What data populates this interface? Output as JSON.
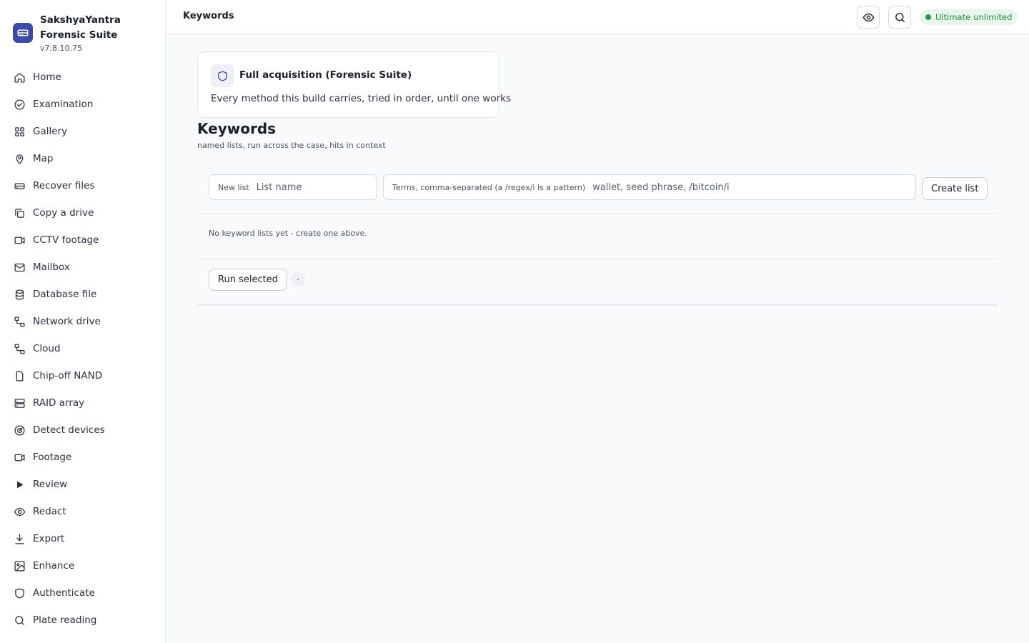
{
  "app": {
    "name": "SakshyaYantra Forensic Suite",
    "version": "v7.8.10.75"
  },
  "sidebar": {
    "items": [
      {
        "label": "Home",
        "icon": "home-icon"
      },
      {
        "label": "Examination",
        "icon": "check-circle-icon"
      },
      {
        "label": "Gallery",
        "icon": "grid-icon"
      },
      {
        "label": "Map",
        "icon": "map-pin-icon"
      },
      {
        "label": "Recover files",
        "icon": "hard-drive-icon"
      },
      {
        "label": "Copy a drive",
        "icon": "copy-icon"
      },
      {
        "label": "CCTV footage",
        "icon": "video-icon"
      },
      {
        "label": "Mailbox",
        "icon": "mail-icon"
      },
      {
        "label": "Database file",
        "icon": "database-icon"
      },
      {
        "label": "Network drive",
        "icon": "network-icon"
      },
      {
        "label": "Cloud",
        "icon": "cloud-icon"
      },
      {
        "label": "Chip-off NAND",
        "icon": "chip-icon"
      },
      {
        "label": "RAID array",
        "icon": "server-icon"
      },
      {
        "label": "Detect devices",
        "icon": "radar-icon"
      },
      {
        "label": "Footage",
        "icon": "video-icon"
      },
      {
        "label": "Review",
        "icon": "play-icon"
      },
      {
        "label": "Redact",
        "icon": "eye-icon"
      },
      {
        "label": "Export",
        "icon": "download-icon"
      },
      {
        "label": "Enhance",
        "icon": "image-icon"
      },
      {
        "label": "Authenticate",
        "icon": "shield-icon"
      },
      {
        "label": "Plate reading",
        "icon": "search-icon"
      }
    ]
  },
  "topbar": {
    "title": "Keywords",
    "license_status": "Ultimate",
    "license_detail": "unlimited",
    "colors": {
      "license_bg": "#e9f6ec",
      "license_text": "#27864a",
      "license_dot": "#1f9a4c"
    }
  },
  "method_card": {
    "title": "Full acquisition (Forensic Suite)",
    "description": "Every method this build carries, tried in order, until one works"
  },
  "page": {
    "title": "Keywords",
    "subtitle": "named lists, run across the case, hits in context"
  },
  "form": {
    "list_name_label": "New list",
    "list_name_placeholder": "List name",
    "terms_label": "Terms, comma-separated (a /regex/i is a pattern)",
    "terms_placeholder": "wallet, seed phrase, /bitcoin/i",
    "create_button": "Create list"
  },
  "lists": {
    "empty_message": "No keyword lists yet - create one above."
  },
  "run": {
    "button": "Run selected",
    "selected_count": "-"
  },
  "colors": {
    "brand": "#3f4aa8",
    "background": "#f8fafc"
  }
}
